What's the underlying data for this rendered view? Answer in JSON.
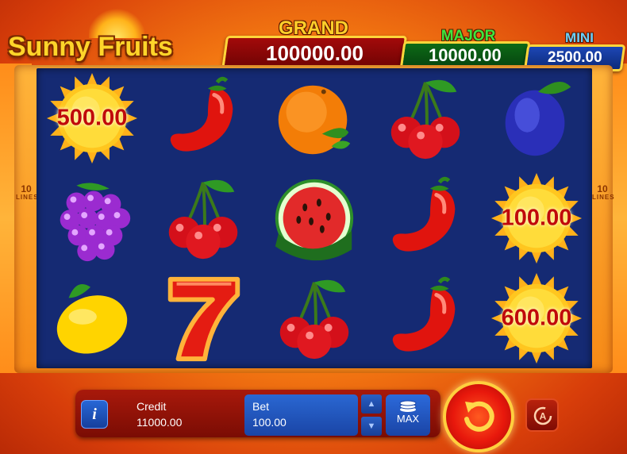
{
  "game": {
    "logo_text": "Sunny Fruits"
  },
  "jackpots": {
    "grand": {
      "label": "GRAND",
      "value": "100000.00"
    },
    "major": {
      "label": "MAJOR",
      "value": "10000.00"
    },
    "mini": {
      "label": "MINI",
      "value": "2500.00"
    }
  },
  "lines_badge": {
    "number": "10",
    "word": "LINES"
  },
  "reels": [
    [
      {
        "symbol": "sun",
        "win_value": "500.00"
      },
      {
        "symbol": "grapes"
      },
      {
        "symbol": "lemon"
      }
    ],
    [
      {
        "symbol": "chili"
      },
      {
        "symbol": "cherries"
      },
      {
        "symbol": "seven"
      }
    ],
    [
      {
        "symbol": "orange"
      },
      {
        "symbol": "watermelon"
      },
      {
        "symbol": "cherries"
      }
    ],
    [
      {
        "symbol": "cherries"
      },
      {
        "symbol": "chili"
      },
      {
        "symbol": "chili"
      }
    ],
    [
      {
        "symbol": "plum"
      },
      {
        "symbol": "sun",
        "win_value": "100.00"
      },
      {
        "symbol": "sun",
        "win_value": "600.00"
      }
    ]
  ],
  "controls": {
    "info_label": "i",
    "credit_label": "Credit",
    "credit_value": "11000.00",
    "bet_label": "Bet",
    "bet_value": "100.00",
    "max_label": "MAX",
    "spin_icon": "spin-arrow-icon",
    "autoplay_icon": "autoplay-icon"
  },
  "colors": {
    "reel_background": "#152a73",
    "win_text": "#c00a0a",
    "grand": "#a30a0a",
    "major": "#0d6a16",
    "mini": "#1d47b5"
  }
}
